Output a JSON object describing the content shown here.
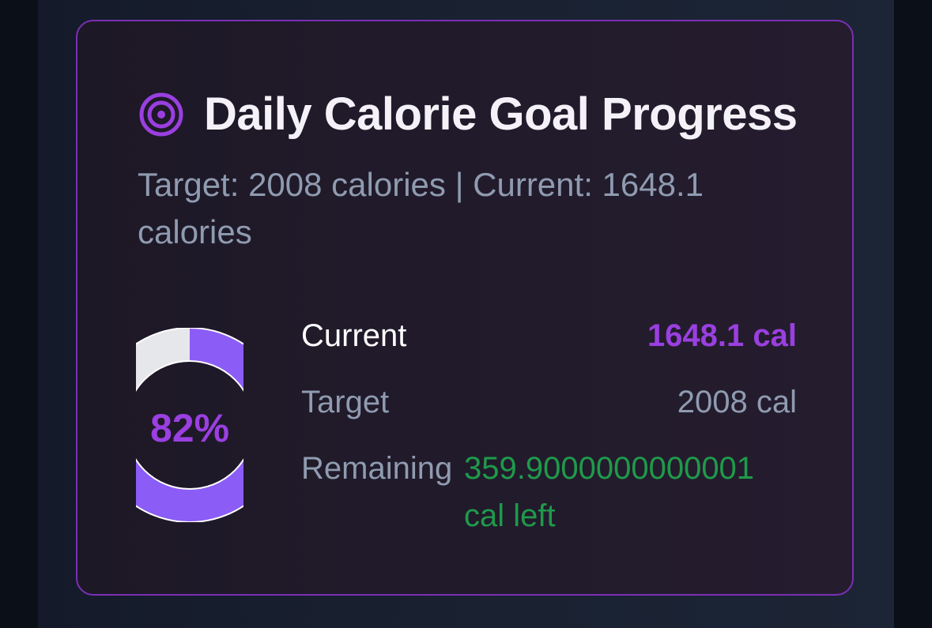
{
  "card": {
    "icon": "target-icon",
    "title": "Daily Calorie Goal Progress",
    "subtitle": "Target: 2008 calories | Current: 1648.1 calories",
    "accent_color": "#9a3fe0",
    "border_color": "#7a2fb5"
  },
  "progress": {
    "percent_label": "82%",
    "fraction": 0.82,
    "filled_color": "#8b5cf6",
    "remaining_color": "#e5e7eb"
  },
  "stats": {
    "current_label": "Current",
    "current_value": "1648.1 cal",
    "target_label": "Target",
    "target_value": "2008 cal",
    "remaining_label": "Remaining",
    "remaining_value": "359.9000000000001 cal left",
    "remaining_color": "#1f9a4a"
  }
}
